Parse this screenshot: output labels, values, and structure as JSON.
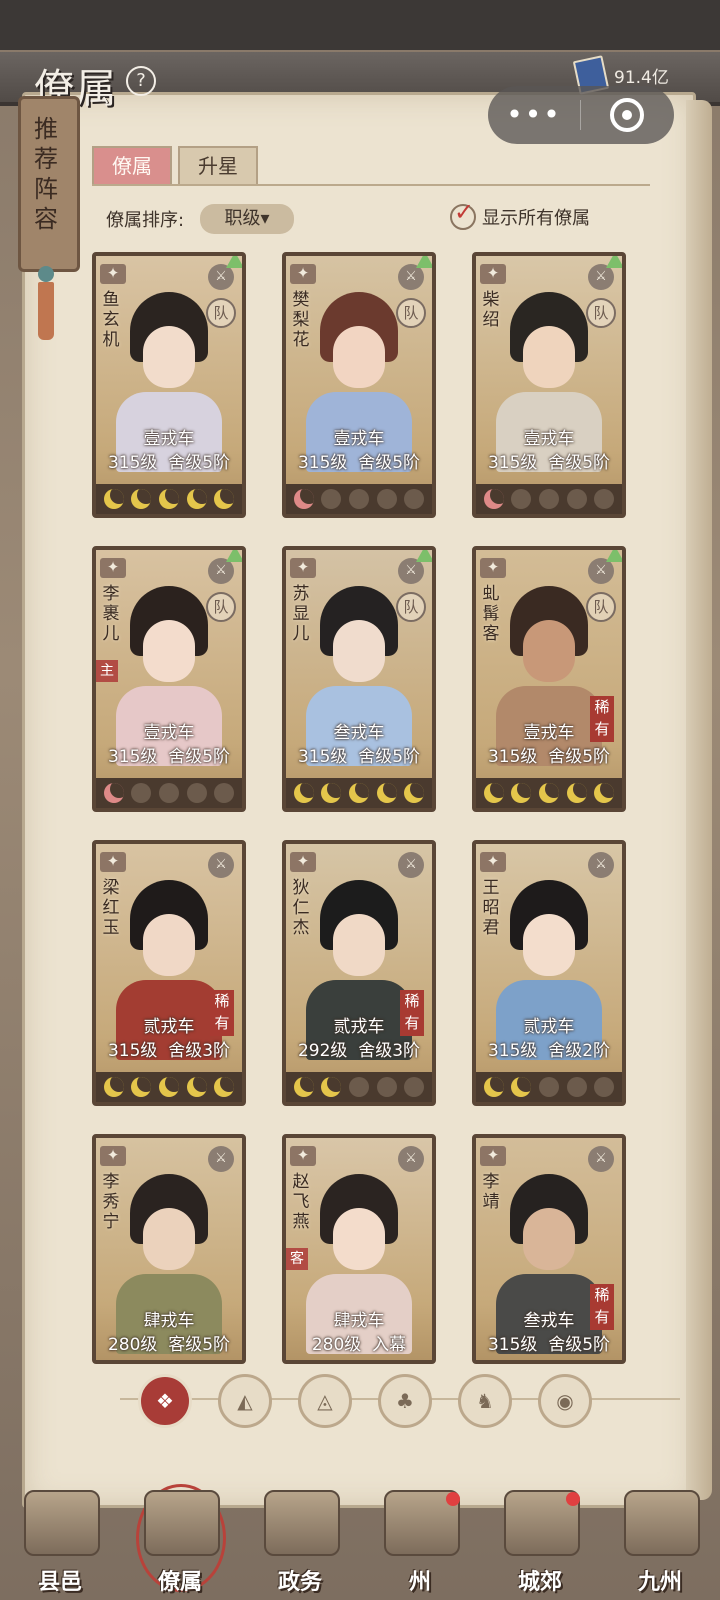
{
  "header": {
    "title": "僚属",
    "help_icon": "?",
    "currency_value": "91.4亿",
    "capsule_more": "•••"
  },
  "banner": {
    "label": "推荐阵容"
  },
  "tabs": [
    {
      "label": "僚属",
      "active": true
    },
    {
      "label": "升星",
      "active": false
    }
  ],
  "sort": {
    "label": "僚属排序:",
    "value": "职级▾"
  },
  "show_all": {
    "label": "显示所有僚属",
    "checked": true
  },
  "cards": [
    {
      "name": "鱼玄机",
      "rank": "壹戎车",
      "level": "315级",
      "stage": "舍级5阶",
      "team": "队",
      "upgrade": true,
      "tag": "",
      "rare": "",
      "stars": [
        "on",
        "on",
        "on",
        "on",
        "on"
      ],
      "palette": {
        "hair": "#2b2420",
        "skin": "#f2dccb",
        "cloth": "#d7d2de",
        "bg": "#d9c4a4"
      }
    },
    {
      "name": "樊梨花",
      "rank": "壹戎车",
      "level": "315级",
      "stage": "舍级5阶",
      "team": "队",
      "upgrade": true,
      "tag": "",
      "rare": "",
      "stars": [
        "red",
        "off",
        "off",
        "off",
        "off"
      ],
      "palette": {
        "hair": "#6b3a2e",
        "skin": "#f2d5c2",
        "cloth": "#9fb4d8",
        "bg": "#d6c3a3"
      }
    },
    {
      "name": "柴绍",
      "rank": "壹戎车",
      "level": "315级",
      "stage": "舍级5阶",
      "team": "队",
      "upgrade": true,
      "tag": "",
      "rare": "",
      "stars": [
        "red",
        "off",
        "off",
        "off",
        "off"
      ],
      "palette": {
        "hair": "#2a2622",
        "skin": "#efd4bd",
        "cloth": "#d9d0c2",
        "bg": "#d9c7a8"
      }
    },
    {
      "name": "李裹儿",
      "rank": "壹戎车",
      "level": "315级",
      "stage": "舍级5阶",
      "team": "队",
      "upgrade": true,
      "tag": "主",
      "rare": "",
      "stars": [
        "red",
        "off",
        "off",
        "off",
        "off"
      ],
      "palette": {
        "hair": "#2b221e",
        "skin": "#f3dccc",
        "cloth": "#e6c8c8",
        "bg": "#d8c2a1"
      }
    },
    {
      "name": "苏显儿",
      "rank": "叁戎车",
      "level": "315级",
      "stage": "舍级5阶",
      "team": "队",
      "upgrade": true,
      "tag": "",
      "rare": "",
      "stars": [
        "on",
        "on",
        "on",
        "on",
        "on"
      ],
      "palette": {
        "hair": "#252222",
        "skin": "#f0dccd",
        "cloth": "#a9c1e0",
        "bg": "#d4c2a5"
      }
    },
    {
      "name": "虬髯客",
      "rank": "壹戎车",
      "level": "315级",
      "stage": "舍级5阶",
      "team": "队",
      "upgrade": true,
      "tag": "",
      "rare": "稀有",
      "stars": [
        "on",
        "on",
        "on",
        "on",
        "on"
      ],
      "palette": {
        "hair": "#3a2a22",
        "skin": "#c89878",
        "cloth": "#b2896a",
        "bg": "#d3bc96"
      }
    },
    {
      "name": "梁红玉",
      "rank": "贰戎车",
      "level": "315级",
      "stage": "舍级3阶",
      "team": "",
      "upgrade": false,
      "tag": "",
      "rare": "稀有",
      "stars": [
        "on",
        "on",
        "on",
        "on",
        "on"
      ],
      "palette": {
        "hair": "#1f1b1a",
        "skin": "#f0d8c6",
        "cloth": "#a33d32",
        "bg": "#d8c3a2"
      }
    },
    {
      "name": "狄仁杰",
      "rank": "贰戎车",
      "level": "292级",
      "stage": "舍级3阶",
      "team": "",
      "upgrade": false,
      "tag": "",
      "rare": "稀有",
      "stars": [
        "on",
        "on",
        "off",
        "off",
        "off"
      ],
      "palette": {
        "hair": "#1c1c1c",
        "skin": "#f0d9c6",
        "cloth": "#3a3f3c",
        "bg": "#d6c5a6"
      }
    },
    {
      "name": "王昭君",
      "rank": "贰戎车",
      "level": "315级",
      "stage": "舍级2阶",
      "team": "",
      "upgrade": false,
      "tag": "",
      "rare": "",
      "stars": [
        "on",
        "on",
        "off",
        "off",
        "off"
      ],
      "palette": {
        "hair": "#1e1b1b",
        "skin": "#f3ddcc",
        "cloth": "#7da1c9",
        "bg": "#d8c6a6"
      }
    },
    {
      "name": "李秀宁",
      "rank": "肆戎车",
      "level": "280级",
      "stage": "客级5阶",
      "team": "",
      "upgrade": false,
      "tag": "",
      "rare": "",
      "stars": [],
      "palette": {
        "hair": "#2a2320",
        "skin": "#ebd2bc",
        "cloth": "#8c8a5e",
        "bg": "#d6c2a0"
      }
    },
    {
      "name": "赵飞燕",
      "rank": "肆戎车",
      "level": "280级",
      "stage": "入幕",
      "team": "",
      "upgrade": false,
      "tag": "客",
      "rare": "",
      "stars": [],
      "palette": {
        "hair": "#2b2421",
        "skin": "#f3dccb",
        "cloth": "#e4cfc7",
        "bg": "#d9c6a8"
      }
    },
    {
      "name": "李靖",
      "rank": "叁戎车",
      "level": "315级",
      "stage": "舍级5阶",
      "team": "",
      "upgrade": false,
      "tag": "",
      "rare": "稀有",
      "stars": [],
      "palette": {
        "hair": "#262220",
        "skin": "#d9b598",
        "cloth": "#4a4a48",
        "bg": "#d3bd99"
      }
    }
  ],
  "filters": [
    {
      "icon": "all-icon",
      "glyph": "❖",
      "active": true
    },
    {
      "icon": "bird-icon",
      "glyph": "◭",
      "active": false
    },
    {
      "icon": "fox-icon",
      "glyph": "◬",
      "active": false
    },
    {
      "icon": "fan-icon",
      "glyph": "♣",
      "active": false
    },
    {
      "icon": "horse-icon",
      "glyph": "♞",
      "active": false
    },
    {
      "icon": "tiger-icon",
      "glyph": "◉",
      "active": false
    }
  ],
  "bottom_nav": [
    {
      "label": "县邑",
      "active": false,
      "dot": false
    },
    {
      "label": "僚属",
      "active": true,
      "dot": false
    },
    {
      "label": "政务",
      "active": false,
      "dot": false
    },
    {
      "label": "州",
      "active": false,
      "dot": true
    },
    {
      "label": "城郊",
      "active": false,
      "dot": true
    },
    {
      "label": "九州",
      "active": false,
      "dot": false
    }
  ]
}
